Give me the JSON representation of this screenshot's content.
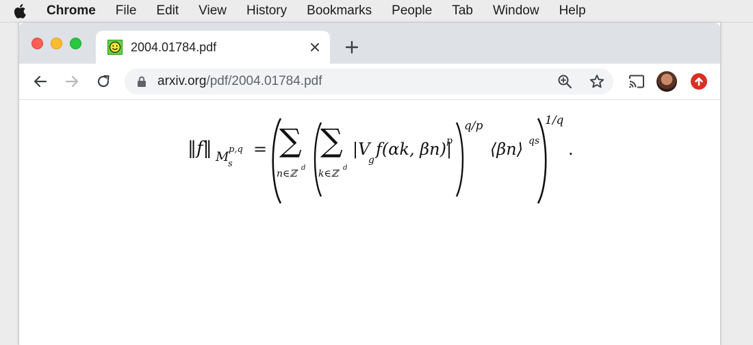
{
  "menubar": {
    "app_name": "Chrome",
    "items": [
      "File",
      "Edit",
      "View",
      "History",
      "Bookmarks",
      "People",
      "Tab",
      "Window",
      "Help"
    ]
  },
  "tab": {
    "title": "2004.01784.pdf",
    "favicon": "smiley-face-icon"
  },
  "omnibox": {
    "host": "arxiv.org",
    "path": "/pdf/2004.01784.pdf"
  },
  "equation": {
    "lhs_norm": "‖f‖",
    "lhs_M": "M",
    "lhs_sub": "s",
    "lhs_sup": "p,q",
    "equals": "=",
    "sum_symbol": "∑",
    "outer_sum_index": "n∈ℤ",
    "outer_sum_index_sup": "d",
    "inner_sum_index": "k∈ℤ",
    "inner_sum_index_sup": "d",
    "integrand": "|V",
    "integrand_sub": "g",
    "integrand_rest": "f(αk, βn)|",
    "integrand_power": "p",
    "inner_power": "q/p",
    "weight": "⟨βn⟩",
    "weight_power": "qs",
    "outer_power": "1/q",
    "period": "."
  },
  "colors": {
    "tabstrip": "#dee1e6",
    "omnibox": "#f1f3f4",
    "close_red": "#fe5f57",
    "minimize_yellow": "#febc2e",
    "zoom_green": "#28c840",
    "update_badge": "#d93025"
  }
}
